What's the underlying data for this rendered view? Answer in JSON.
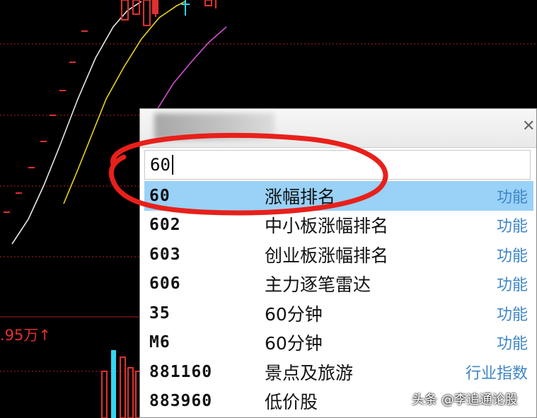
{
  "chart": {
    "volume_label": ".95万↑",
    "colors": {
      "white_ma": "#e6e6e6",
      "yellow_ma": "#e8d21a",
      "magenta_ma": "#d050d0",
      "grid_red": "#b02020",
      "up_red": "#e03030",
      "down_cyan": "#34d6f0"
    }
  },
  "wizard": {
    "input_value": "60",
    "results": [
      {
        "code": "60",
        "name": "涨幅排名",
        "type": "功能",
        "selected": true
      },
      {
        "code": "602",
        "name": "中小板涨幅排名",
        "type": "功能",
        "selected": false
      },
      {
        "code": "603",
        "name": "创业板涨幅排名",
        "type": "功能",
        "selected": false
      },
      {
        "code": "606",
        "name": "主力逐笔雷达",
        "type": "功能",
        "selected": false
      },
      {
        "code": "35",
        "name": "60分钟",
        "type": "功能",
        "selected": false
      },
      {
        "code": "M6",
        "name": "60分钟",
        "type": "功能",
        "selected": false
      },
      {
        "code": "881160",
        "name": "景点及旅游",
        "type": "行业指数",
        "selected": false
      },
      {
        "code": "883960",
        "name": "低价股",
        "type": "",
        "selected": false
      }
    ]
  },
  "watermark": "头条 @李追通论股"
}
